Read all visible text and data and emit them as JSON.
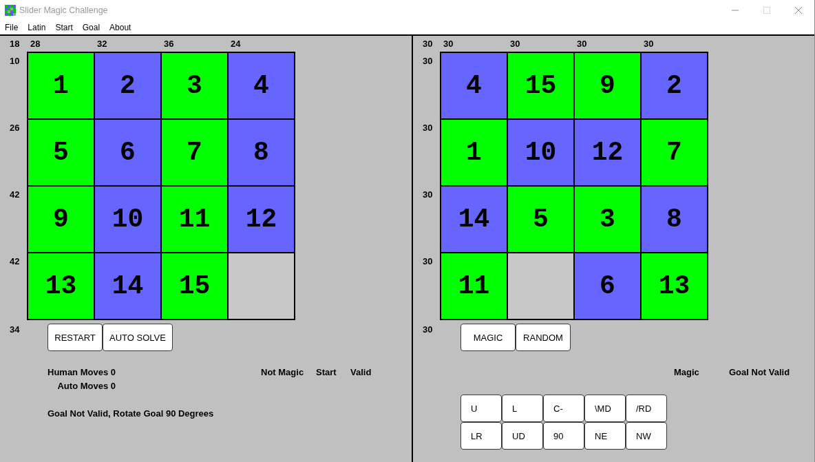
{
  "window": {
    "title": "Slider Magic Challenge",
    "maximize_disabled": true
  },
  "menu": [
    "File",
    "Latin",
    "Start",
    "Goal",
    "About"
  ],
  "panels": [
    {
      "top_left_sum": "18",
      "column_sums": [
        "28",
        "32",
        "36",
        "24"
      ],
      "row_sums": [
        "10",
        "26",
        "42",
        "42"
      ],
      "bottom_left_sum": "34",
      "board": [
        [
          {
            "kind": "number",
            "label": "1",
            "color": "#00ff00"
          },
          {
            "kind": "number",
            "label": "2",
            "color": "#6666ff"
          },
          {
            "kind": "number",
            "label": "3",
            "color": "#00ff00"
          },
          {
            "kind": "number",
            "label": "4",
            "color": "#6666ff"
          }
        ],
        [
          {
            "kind": "number",
            "label": "5",
            "color": "#00ff00"
          },
          {
            "kind": "number",
            "label": "6",
            "color": "#6666ff"
          },
          {
            "kind": "number",
            "label": "7",
            "color": "#00ff00"
          },
          {
            "kind": "number",
            "label": "8",
            "color": "#6666ff"
          }
        ],
        [
          {
            "kind": "number",
            "label": "9",
            "color": "#00ff00"
          },
          {
            "kind": "number",
            "label": "10",
            "color": "#6666ff"
          },
          {
            "kind": "number",
            "label": "11",
            "color": "#00ff00"
          },
          {
            "kind": "number",
            "label": "12",
            "color": "#6666ff"
          }
        ],
        [
          {
            "kind": "number",
            "label": "13",
            "color": "#00ff00"
          },
          {
            "kind": "number",
            "label": "14",
            "color": "#6666ff"
          },
          {
            "kind": "number",
            "label": "15",
            "color": "#00ff00"
          },
          {
            "kind": "blank"
          }
        ]
      ],
      "buttons": [
        "RESTART",
        "AUTO SOLVE"
      ],
      "moves": [
        "Human Moves 0",
        "Auto Moves 0"
      ],
      "flags": [
        "Not Magic",
        "Start",
        "Valid"
      ],
      "message": "Goal Not Valid, Rotate Goal 90 Degrees"
    },
    {
      "top_left_sum": "30",
      "column_sums": [
        "30",
        "30",
        "30",
        "30"
      ],
      "row_sums": [
        "30",
        "30",
        "30",
        "30"
      ],
      "bottom_left_sum": "30",
      "board": [
        [
          {
            "kind": "number",
            "label": "4",
            "color": "#6666ff"
          },
          {
            "kind": "number",
            "label": "15",
            "color": "#00ff00"
          },
          {
            "kind": "number",
            "label": "9",
            "color": "#00ff00"
          },
          {
            "kind": "number",
            "label": "2",
            "color": "#6666ff"
          }
        ],
        [
          {
            "kind": "number",
            "label": "1",
            "color": "#00ff00"
          },
          {
            "kind": "number",
            "label": "10",
            "color": "#6666ff"
          },
          {
            "kind": "number",
            "label": "12",
            "color": "#6666ff"
          },
          {
            "kind": "number",
            "label": "7",
            "color": "#00ff00"
          }
        ],
        [
          {
            "kind": "number",
            "label": "14",
            "color": "#6666ff"
          },
          {
            "kind": "number",
            "label": "5",
            "color": "#00ff00"
          },
          {
            "kind": "number",
            "label": "3",
            "color": "#00ff00"
          },
          {
            "kind": "number",
            "label": "8",
            "color": "#6666ff"
          }
        ],
        [
          {
            "kind": "number",
            "label": "11",
            "color": "#00ff00"
          },
          {
            "kind": "blank"
          },
          {
            "kind": "number",
            "label": "6",
            "color": "#6666ff"
          },
          {
            "kind": "number",
            "label": "13",
            "color": "#00ff00"
          }
        ]
      ],
      "buttons": [
        "MAGIC",
        "RANDOM"
      ],
      "flags": [
        "Magic",
        "Goal Not Valid"
      ],
      "transform_buttons": [
        [
          "U",
          "L",
          "C-",
          "\\MD",
          "/RD"
        ],
        [
          "LR",
          "UD",
          "90",
          "NE",
          "NW"
        ]
      ]
    }
  ]
}
